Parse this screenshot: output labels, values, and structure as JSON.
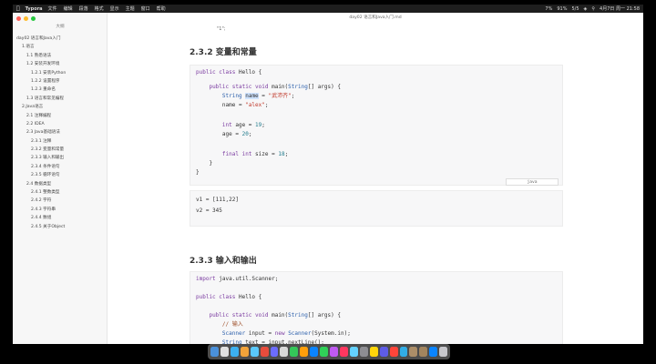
{
  "menubar": {
    "app": "Typora",
    "items": [
      "文件",
      "编辑",
      "段落",
      "格式",
      "显示",
      "主题",
      "窗口",
      "帮助"
    ],
    "status": [
      "7%",
      "91%",
      "5/5",
      "B"
    ],
    "clock": "4月7日 周一 21:58"
  },
  "window": {
    "title": "day02 语言和Java入门.md",
    "sidebar_title": "大纲",
    "traffic_colors": [
      "#ff5f57",
      "#febc2e",
      "#28c840"
    ]
  },
  "toc": [
    {
      "level": 1,
      "label": "day02 语言和Java入门"
    },
    {
      "level": 2,
      "label": "1.语言"
    },
    {
      "level": 3,
      "label": "1.1 熟悉语法"
    },
    {
      "level": 3,
      "label": "1.2 安装开发环境"
    },
    {
      "level": 4,
      "label": "1.2.1 安装Python"
    },
    {
      "level": 4,
      "label": "1.2.2 设置程序"
    },
    {
      "level": 4,
      "label": "1.2.3 重命名"
    },
    {
      "level": 3,
      "label": "1.3 语言和常见编程"
    },
    {
      "level": 2,
      "label": "2.Java语言"
    },
    {
      "level": 3,
      "label": "2.1 注释编程"
    },
    {
      "level": 3,
      "label": "2.2 IDEA"
    },
    {
      "level": 3,
      "label": "2.3 Java基础语法"
    },
    {
      "level": 4,
      "label": "2.3.1 注释"
    },
    {
      "level": 4,
      "label": "2.3.2 变量和常量"
    },
    {
      "level": 4,
      "label": "2.3.3 输入和输出"
    },
    {
      "level": 4,
      "label": "2.3.4 条件语句"
    },
    {
      "level": 4,
      "label": "2.3.5 循环语句"
    },
    {
      "level": 3,
      "label": "2.4 数据类型"
    },
    {
      "level": 4,
      "label": "2.4.1 整数类型"
    },
    {
      "level": 4,
      "label": "2.4.2 字符"
    },
    {
      "level": 4,
      "label": "2.4.3 字符串"
    },
    {
      "level": 4,
      "label": "2.4.4 数组"
    },
    {
      "level": 4,
      "label": "2.4.5 关于Object"
    }
  ],
  "content": {
    "top_fragment": "\"1\";",
    "heading1": "2.3.2 变量和常量",
    "heading2": "2.3.3 输入和输出",
    "code1_lang": "java",
    "code1": [
      [
        "public class Hello {"
      ],
      [
        ""
      ],
      [
        "    public static void main(String[] args) {"
      ],
      [
        "        String name = \"武沛齐\";"
      ],
      [
        "        name = \"alex\";"
      ],
      [
        ""
      ],
      [
        "        int age = 19;"
      ],
      [
        "        age = 20;"
      ],
      [
        ""
      ],
      [
        "        final int size = 18;"
      ],
      [
        "    }"
      ],
      [
        "}"
      ]
    ],
    "output": [
      "v1 = [111,22]",
      "v2 = 345"
    ],
    "code2": [
      [
        "import java.util.Scanner;"
      ],
      [
        ""
      ],
      [
        "public class Hello {"
      ],
      [
        ""
      ],
      [
        "    public static void main(String[] args) {"
      ],
      [
        "        // 输入"
      ],
      [
        "        Scanner input = new Scanner(System.in);"
      ],
      [
        "        String text = input.nextLine();"
      ]
    ]
  },
  "dock_colors": [
    "#4a90d9",
    "#e0e0e0",
    "#3cb0f0",
    "#f2a33a",
    "#5ac8fa",
    "#e74c3c",
    "#6c6cff",
    "#d9d9d9",
    "#34c759",
    "#ff9f0a",
    "#0a84ff",
    "#30d158",
    "#bf5af2",
    "#ff375f",
    "#64d2ff",
    "#8e8e93",
    "#ffd60a",
    "#5e5ce6",
    "#ff453a",
    "#32ade6",
    "#ac8e68",
    "#a2845e",
    "#0a84ff",
    "#c7c7cc"
  ]
}
